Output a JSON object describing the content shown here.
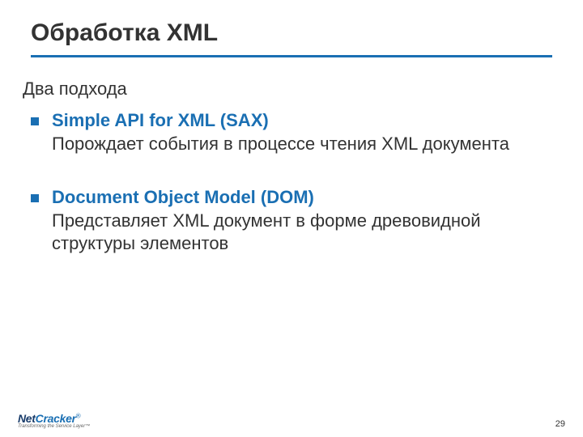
{
  "title": "Обработка XML",
  "intro": "Два подхода",
  "bullets": [
    {
      "title": "Simple API for XML (SAX)",
      "desc": "Порождает события в процессе чтения XML документа"
    },
    {
      "title": "Document Object Model (DOM)",
      "desc": "Представляет XML документ в форме древовидной структуры элементов"
    }
  ],
  "logo": {
    "net": "Net",
    "cracker": "Cracker",
    "reg": "®",
    "tag": "Transforming the Service Layer™"
  },
  "pageNumber": "29",
  "colors": {
    "accent": "#1a6fb3"
  }
}
